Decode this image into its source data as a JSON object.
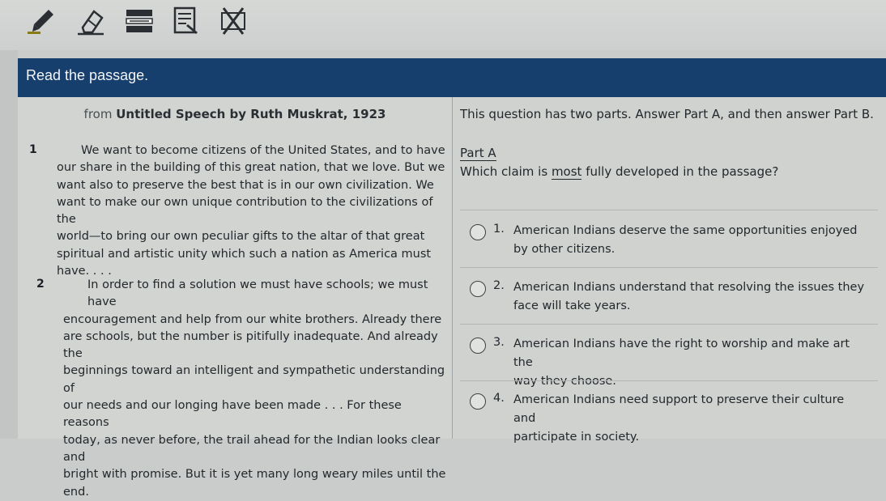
{
  "toolbar": {
    "tools": [
      {
        "icon": "highlighter-icon"
      },
      {
        "icon": "eraser-icon"
      },
      {
        "icon": "line-reader-icon"
      },
      {
        "icon": "notepad-icon"
      },
      {
        "icon": "answer-eliminator-icon"
      }
    ]
  },
  "header": {
    "title": "Read the passage."
  },
  "passage": {
    "from_prefix": "from",
    "title": "Untitled Speech by Ruth Muskrat, 1923",
    "paragraphs": [
      {
        "number": "1",
        "lines": [
          "We want to become citizens of the United States, and to have",
          "our share in the building of this great nation, that we love. But we",
          "want also to preserve the best that is in our own civilization. We",
          "want to make our own unique contribution to the civilizations of the",
          "world—to bring our own peculiar gifts to the altar of that great",
          "spiritual and artistic unity which such a nation as America must",
          "have. . . ."
        ]
      },
      {
        "number": "2",
        "lines": [
          "In order to find a solution we must have schools; we must have",
          "encouragement and help from our white brothers. Already there",
          "are schools, but the number is pitifully inadequate. And already the",
          "beginnings toward an intelligent and sympathetic understanding of",
          "our needs and our longing have been made . . . For these reasons",
          "today, as never before, the trail ahead for the Indian looks clear and",
          "bright with promise. But it is yet many long weary miles until the",
          "end."
        ]
      }
    ]
  },
  "question": {
    "intro": "This question has two parts. Answer Part A, and then answer Part B.",
    "part_label": "Part A",
    "stem_before": "Which claim is ",
    "stem_emph": "most",
    "stem_after": " fully developed in the passage?",
    "options": [
      {
        "number": "1.",
        "lines": [
          "American Indians deserve the same opportunities enjoyed",
          "by other citizens."
        ]
      },
      {
        "number": "2.",
        "lines": [
          "American Indians understand that resolving the issues they",
          "face will take years."
        ]
      },
      {
        "number": "3.",
        "lines": [
          "American Indians have the right to worship and make art the",
          "way they choose."
        ]
      },
      {
        "number": "4.",
        "lines": [
          "American Indians need support to preserve their culture and",
          "participate in society."
        ]
      }
    ]
  },
  "colors": {
    "header_bg": "#173f6e",
    "page_bg": "#d2d4d2"
  }
}
